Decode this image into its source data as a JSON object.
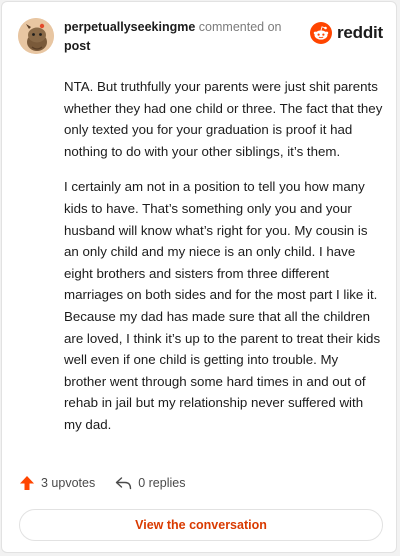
{
  "header": {
    "username": "perpetuallyseekingme",
    "action": "commented on",
    "target": "post",
    "brand": "reddit"
  },
  "comment": {
    "paragraphs": [
      "NTA. But truthfully your parents were just shit parents whether they had one child or three. The fact that they only texted you for your graduation is proof it had nothing to do with your other siblings, it’s them.",
      "I certainly am not in a position to tell you how many kids to have. That’s something only you and your husband will know what’s right for you. My cousin is an only child and my niece is an only child. I have eight brothers and sisters from three different marriages on both sides and for the most part I like it. Because my dad has made sure that all the children are loved, I think it’s up to the parent to treat their kids well even if one child is getting into trouble. My brother went through some hard times in and out of rehab in jail but my relationship never suffered with my dad."
    ]
  },
  "footer": {
    "upvotes": "3 upvotes",
    "replies": "0 replies",
    "cta": "View the conversation"
  },
  "colors": {
    "accent": "#ff4500",
    "cta_text": "#d93a00"
  },
  "icons": [
    "user-avatar",
    "reddit-logo-icon",
    "upvote-arrow-icon",
    "reply-icon"
  ]
}
